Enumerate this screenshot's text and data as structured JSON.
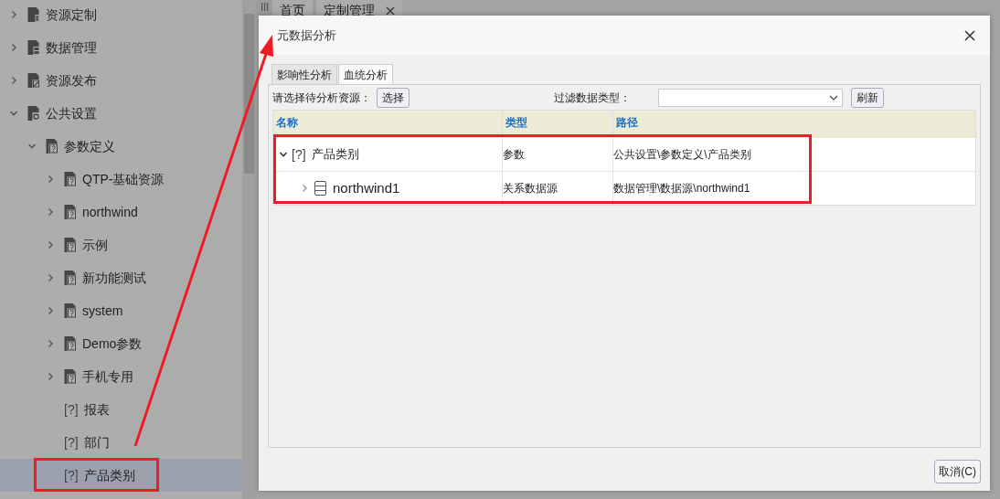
{
  "background_tabs": [
    {
      "label": "首页",
      "closable": false
    },
    {
      "label": "定制管理",
      "closable": true
    }
  ],
  "sidebar": {
    "items": [
      {
        "label": "资源定制",
        "kind": "custom",
        "expanded": false,
        "selected": false
      },
      {
        "label": "数据管理",
        "kind": "data",
        "expanded": false,
        "selected": false
      },
      {
        "label": "资源发布",
        "kind": "publish",
        "expanded": false,
        "selected": false
      },
      {
        "label": "公共设置",
        "kind": "settings",
        "expanded": true,
        "selected": false,
        "children": [
          {
            "label": "参数定义",
            "kind": "folder",
            "expanded": true,
            "selected": false,
            "children": [
              {
                "label": "QTP-基础资源",
                "kind": "folder",
                "expanded": false,
                "selected": false
              },
              {
                "label": "northwind",
                "kind": "folder",
                "expanded": false,
                "selected": false
              },
              {
                "label": "示例",
                "kind": "folder",
                "expanded": false,
                "selected": false
              },
              {
                "label": "新功能测试",
                "kind": "folder",
                "expanded": false,
                "selected": false
              },
              {
                "label": "system",
                "kind": "folder",
                "expanded": false,
                "selected": false
              },
              {
                "label": "Demo参数",
                "kind": "folder",
                "expanded": false,
                "selected": false
              },
              {
                "label": "手机专用",
                "kind": "folder",
                "expanded": false,
                "selected": false
              },
              {
                "label": "报表",
                "kind": "param",
                "icon_text": "[?]",
                "selected": false
              },
              {
                "label": "部门",
                "kind": "param",
                "icon_text": "[?]",
                "selected": false
              },
              {
                "label": "产品类别",
                "kind": "param",
                "icon_text": "[?]",
                "selected": true
              }
            ]
          }
        ]
      }
    ]
  },
  "dialog": {
    "title": "元数据分析",
    "tabs": [
      {
        "label": "影响性分析",
        "selected": false
      },
      {
        "label": "血统分析",
        "selected": true
      }
    ],
    "toolbar": {
      "resource_label": "请选择待分析资源：",
      "select_button": "选择",
      "filter_label": "过滤数据类型：",
      "refresh_button": "刷新"
    },
    "table": {
      "columns": [
        "名称",
        "类型",
        "路径"
      ],
      "rows": [
        {
          "name": "产品类别",
          "kind": "param",
          "icon_text": "[?]",
          "type": "参数",
          "path": "公共设置\\参数定义\\产品类别",
          "expanded": true,
          "children": [
            {
              "name": "northwind1",
              "kind": "datasource",
              "type": "关系数据源",
              "path": "数据管理\\数据源\\northwind1",
              "expanded": false
            }
          ]
        }
      ]
    },
    "buttons": [
      "取消(C)"
    ]
  }
}
